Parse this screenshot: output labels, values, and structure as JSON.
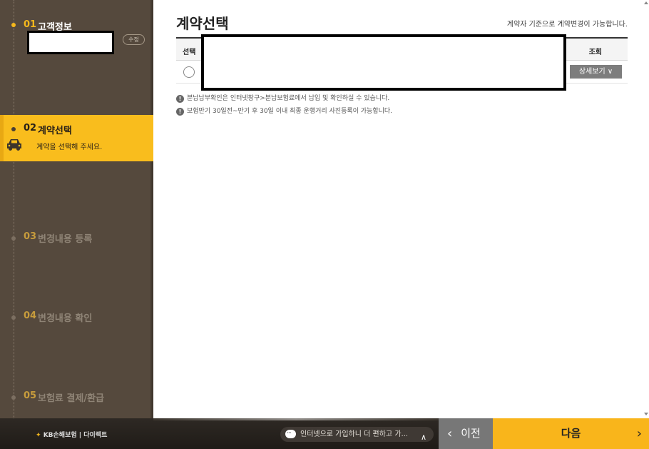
{
  "sidebar": {
    "steps": [
      {
        "num": "01",
        "label": "고객정보",
        "edit": "수정"
      },
      {
        "num": "02",
        "label": "계약선택",
        "desc": "계약을 선택해 주세요."
      },
      {
        "num": "03",
        "label": "변경내용 등록"
      },
      {
        "num": "04",
        "label": "변경내용 확인"
      },
      {
        "num": "05",
        "label": "보험료 결제/환급"
      }
    ]
  },
  "main": {
    "title": "계약선택",
    "notice": "계약자 기준으로 계약변경이 가능합니다.",
    "table": {
      "col_select": "선택",
      "col_view": "조회",
      "detail_button": "상세보기 ∨"
    },
    "notes": [
      "분납납부확인은 인터넷창구>분납보험료에서 납입 및 확인하실 수 있습니다.",
      "보험만기 30일전~만기 후 30일 이내 최종 운행거리 사진등록이 가능합니다."
    ]
  },
  "footer": {
    "brand_logo": "KB손해보험",
    "brand_sep": "|",
    "brand_sub": "다이렉트",
    "chat_text": "인터넷으로 가입하니 더 편하고 가...",
    "prev": "이전",
    "next": "다음"
  }
}
